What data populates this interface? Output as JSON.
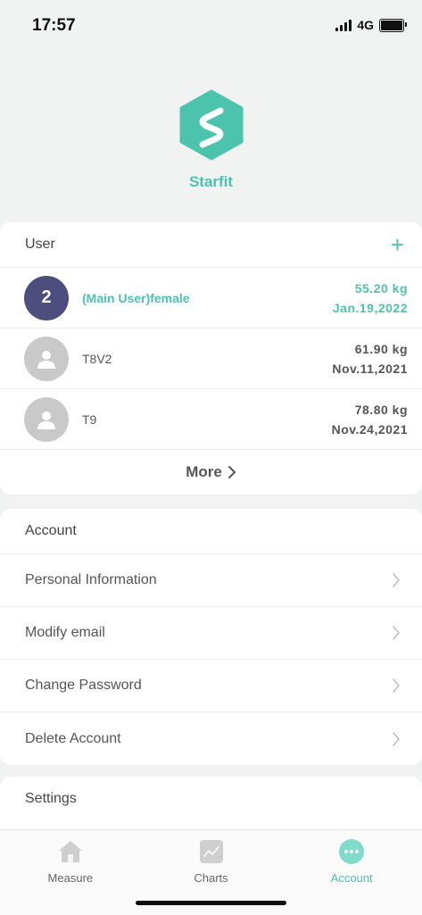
{
  "status": {
    "time": "17:57",
    "network": "4G"
  },
  "app": {
    "name": "Starfit",
    "accent": "#4cc3ad"
  },
  "user_section": {
    "title": "User",
    "add_icon": "plus-icon",
    "users": [
      {
        "avatar_text": "2",
        "name": "(Main User)female",
        "weight": "55.20 kg",
        "date": "Jan.19,2022",
        "main": true
      },
      {
        "avatar_text": "",
        "name": "T8V2",
        "weight": "61.90 kg",
        "date": "Nov.11,2021",
        "main": false
      },
      {
        "avatar_text": "",
        "name": "T9",
        "weight": "78.80 kg",
        "date": "Nov.24,2021",
        "main": false
      }
    ],
    "more_label": "More"
  },
  "account_section": {
    "title": "Account",
    "items": [
      {
        "label": "Personal Information"
      },
      {
        "label": "Modify email"
      },
      {
        "label": "Change Password"
      },
      {
        "label": "Delete Account"
      }
    ]
  },
  "settings_section": {
    "title": "Settings"
  },
  "tabs": [
    {
      "label": "Measure",
      "icon": "home-icon"
    },
    {
      "label": "Charts",
      "icon": "chart-icon"
    },
    {
      "label": "Account",
      "icon": "account-icon",
      "active": true
    }
  ]
}
